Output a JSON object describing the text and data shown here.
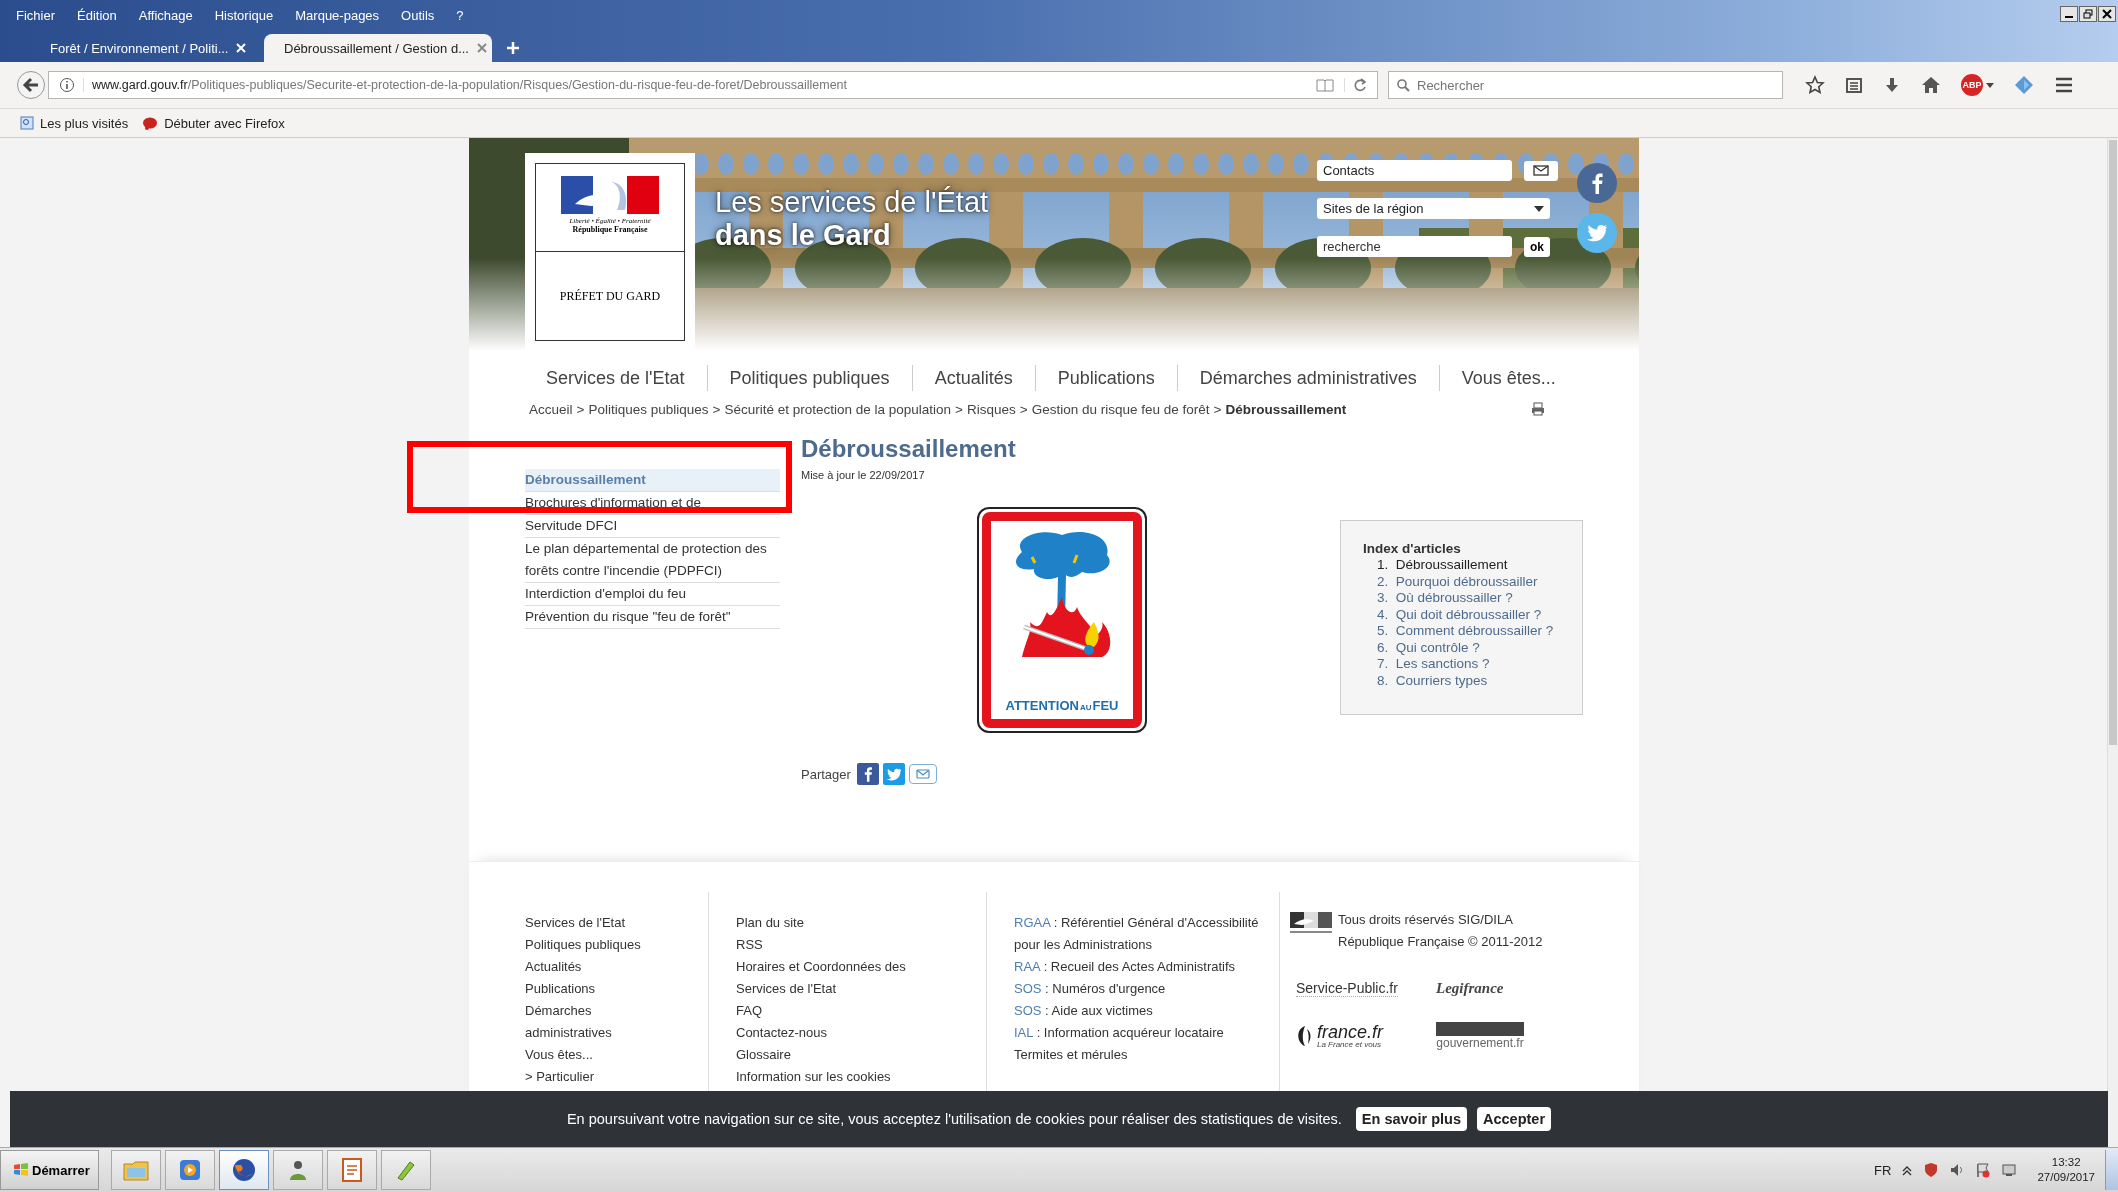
{
  "browser": {
    "menu": [
      "Fichier",
      "Édition",
      "Affichage",
      "Historique",
      "Marque-pages",
      "Outils",
      "?"
    ],
    "tabs": [
      {
        "title": "Forêt / Environnement / Politi...",
        "selected": false
      },
      {
        "title": "Débroussaillement / Gestion d...",
        "selected": true
      }
    ],
    "url_host": "www.gard.gouv.fr",
    "url_path": "/Politiques-publiques/Securite-et-protection-de-la-population/Risques/Gestion-du-risque-feu-de-foret/Debroussaillement",
    "search_placeholder": "Rechercher",
    "adblock_label": "ABP",
    "bookmarks": [
      "Les plus visités",
      "Débuter avec Firefox"
    ]
  },
  "header": {
    "marianne_motto": "Liberté • Égalité • Fraternité",
    "republic": "République Française",
    "prefect": "PRÉFET DU GARD",
    "title_line1": "Les services de l'État",
    "title_line2": "dans le Gard",
    "contacts": "Contacts",
    "region_select": "Sites de la région",
    "search_placeholder": "recherche",
    "search_button": "ok"
  },
  "nav": [
    "Services de l'Etat",
    "Politiques publiques",
    "Actualités",
    "Publications",
    "Démarches administratives",
    "Vous êtes..."
  ],
  "breadcrumb": {
    "separator": ">",
    "items": [
      "Accueil",
      "Politiques publiques",
      "Sécurité et protection de la population",
      "Risques",
      "Gestion du risque feu de forêt",
      "Débroussaillement"
    ]
  },
  "sidebar": [
    {
      "label": "Débroussaillement",
      "selected": true
    },
    {
      "label": "Brochures d'information et de",
      "selected": false
    },
    {
      "label": "Servitude DFCI",
      "selected": false
    },
    {
      "label": "Le plan départemental de protection des forêts contre l'incendie (PDPFCI)",
      "selected": false
    },
    {
      "label": "Interdiction d'emploi du feu",
      "selected": false
    },
    {
      "label": "Prévention du risque \"feu de forêt\"",
      "selected": false
    }
  ],
  "article": {
    "title": "Débroussaillement",
    "updated": "Mise à jour le 22/09/2017",
    "sign_caption": [
      {
        "text": "ATTENTION",
        "small": false
      },
      {
        "text": "AU",
        "small": true
      },
      {
        "text": "FEU",
        "small": false
      }
    ],
    "index": {
      "title": "Index d'articles",
      "items": [
        {
          "number": "1.",
          "label": "Débroussaillement",
          "selected": true
        },
        {
          "number": "2.",
          "label": "Pourquoi débroussailler",
          "selected": false
        },
        {
          "number": "3.",
          "label": "Où débroussailler ?",
          "selected": false
        },
        {
          "number": "4.",
          "label": "Qui doit débroussailler ?",
          "selected": false
        },
        {
          "number": "5.",
          "label": "Comment débroussailler ?",
          "selected": false
        },
        {
          "number": "6.",
          "label": "Qui contrôle ?",
          "selected": false
        },
        {
          "number": "7.",
          "label": "Les sanctions ?",
          "selected": false
        },
        {
          "number": "8.",
          "label": "Courriers types",
          "selected": false
        }
      ]
    },
    "share": "Partager"
  },
  "footer": {
    "col1": [
      "Services de l'Etat",
      "Politiques publiques",
      "Actualités",
      "Publications",
      "Démarches administratives",
      "Vous êtes...",
      "> Particulier"
    ],
    "col2": [
      "Plan du site",
      "RSS",
      "Horaires et Coordonnées des Services de l'Etat",
      "FAQ",
      "Contactez-nous",
      "Glossaire",
      "Information sur les cookies"
    ],
    "col3": [
      {
        "abbr": "RGAA",
        "text": ": Référentiel Général d'Accessibilité pour les Administrations"
      },
      {
        "abbr": "RAA",
        "text": ": Recueil des Actes Administratifs"
      },
      {
        "abbr": "SOS",
        "text": ": Numéros d'urgence"
      },
      {
        "abbr": "SOS",
        "text": ": Aide aux victimes"
      },
      {
        "abbr": "IAL",
        "text": ": Information acquéreur locataire"
      },
      {
        "text": "Termites et mérules"
      }
    ],
    "copyright": "Tous droits réservés SIG/DILA République Française © 2011-2012",
    "logos": [
      {
        "kind": "service-public",
        "name": "Service-Public.fr"
      },
      {
        "kind": "legifrance",
        "name": "Legifrance"
      },
      {
        "kind": "france",
        "name": "france.fr",
        "tagline": "La France et vous"
      },
      {
        "kind": "gouvernement",
        "name": "gouvernement.fr"
      }
    ]
  },
  "cookie_bar": {
    "text": "En poursuivant votre navigation sur ce site, vous acceptez l'utilisation de cookies pour réaliser des statistiques de visites.",
    "buttons": [
      "En savoir plus",
      "Accepter"
    ]
  },
  "taskbar": {
    "start": "Démarrer",
    "language": "FR",
    "time": "13:32",
    "date": "27/09/2017"
  }
}
